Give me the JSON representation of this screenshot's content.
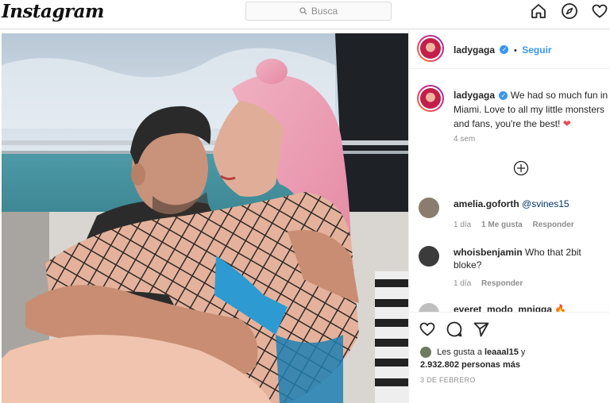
{
  "header": {
    "logo_text": "Instagram",
    "search_placeholder": "Busca"
  },
  "post": {
    "author": "ladygaga",
    "follow_label": "Seguir",
    "separator": "•",
    "caption_text": "We had so much fun in Miami. Love to all my little monsters and fans, you're the best! ❤",
    "caption_time": "4 sem",
    "comments": [
      {
        "user": "amelia.goforth",
        "text": "@svines15",
        "meta": [
          "1 día",
          "1 Me gusta",
          "Responder"
        ]
      },
      {
        "user": "whoisbenjamin",
        "text": "Who that 2bit bloke?",
        "meta": [
          "1 día",
          "Responder"
        ]
      },
      {
        "user": "everet_modo_mnigga",
        "text": "🔥",
        "meta": []
      }
    ],
    "likes_prefix": "Les gusta a",
    "likes_user": "leaaal15",
    "likes_joiner": "y",
    "likes_count": "2.932.802 personas más",
    "date": "3 DE FEBRERO"
  },
  "colors": {
    "link_blue": "#3897f0",
    "muted_gray": "#8e8e8e",
    "border": "#dbdbdb",
    "heart_red": "#ed4956"
  },
  "icons": [
    "search-icon",
    "home-icon",
    "explore-icon",
    "heart-icon",
    "add-comment-icon",
    "like-icon",
    "comment-icon",
    "share-icon",
    "verified-icon"
  ]
}
